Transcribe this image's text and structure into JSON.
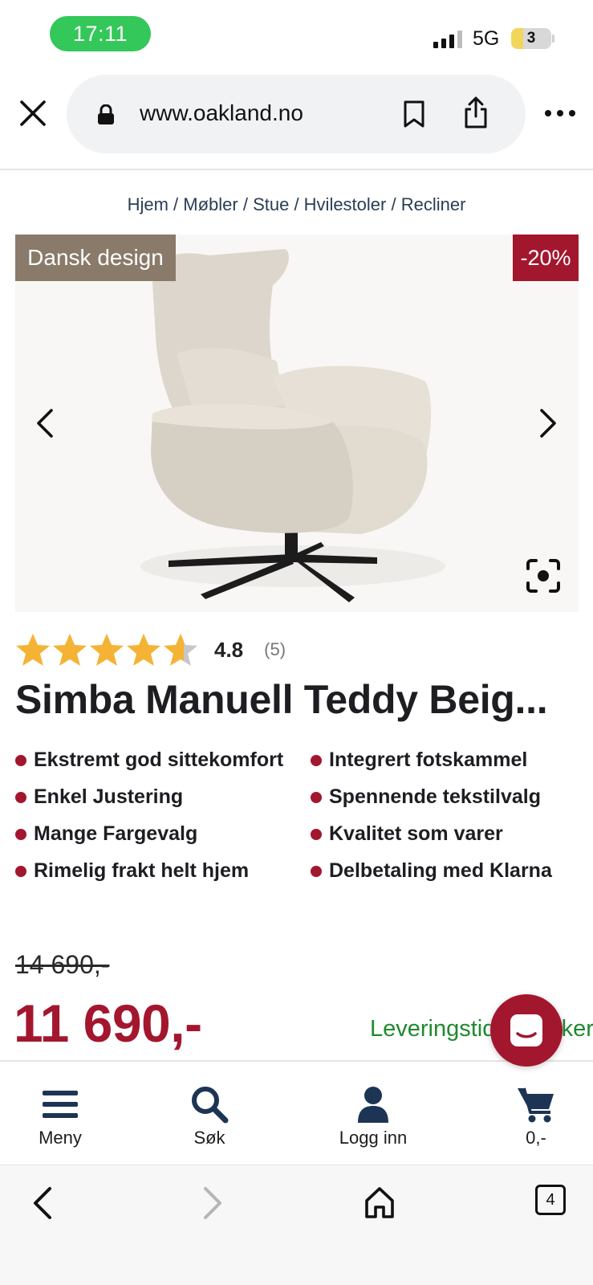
{
  "status_bar": {
    "time": "17:11",
    "network": "5G",
    "battery_level": "3"
  },
  "browser": {
    "url": "www.oakland.no",
    "tab_count": "4"
  },
  "breadcrumb": "Hjem / Møbler / Stue / Hvilestoler / Recliner",
  "badges": {
    "design": "Dansk design",
    "discount": "-20%"
  },
  "rating": {
    "stars": 4.8,
    "score": "4.8",
    "count": "(5)"
  },
  "product": {
    "title": "Simba Manuell Teddy Beig...",
    "features": [
      "Ekstremt god sittekomfort",
      "Integrert fotskammel",
      "Enkel Justering",
      "Spennende tekstilvalg",
      "Mange Fargevalg",
      "Kvalitet som varer",
      "Rimelig frakt helt hjem",
      "Delbetaling med Klarna"
    ],
    "old_price": "14 690,-",
    "price": "11 690,-",
    "delivery": "Leveringstid: 6-8 uker"
  },
  "site_nav": {
    "menu": "Meny",
    "search": "Søk",
    "login": "Logg inn",
    "cart": "0,-"
  },
  "colors": {
    "accent": "#a3172e",
    "design_badge": "#8a7a6a",
    "status_green": "#34c759",
    "delivery_green": "#1f8a2f",
    "nav_navy": "#1e3454"
  }
}
